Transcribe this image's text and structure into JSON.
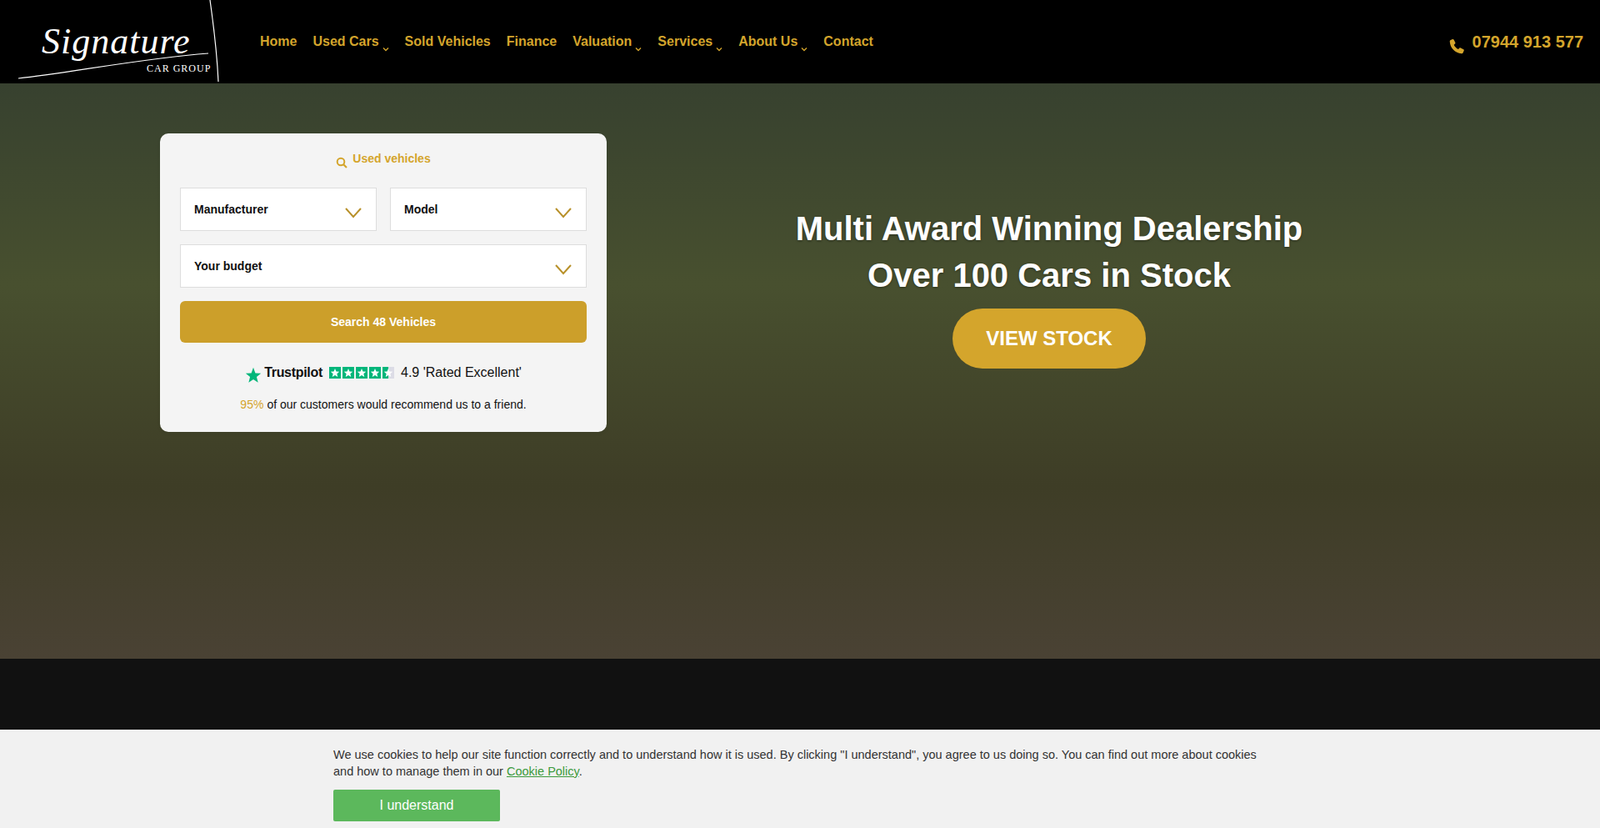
{
  "header": {
    "logo": {
      "script": "Signature",
      "sub": "CAR GROUP"
    },
    "nav": [
      {
        "label": "Home",
        "dropdown": false
      },
      {
        "label": "Used Cars",
        "dropdown": true
      },
      {
        "label": "Sold Vehicles",
        "dropdown": false
      },
      {
        "label": "Finance",
        "dropdown": false
      },
      {
        "label": "Valuation",
        "dropdown": true
      },
      {
        "label": "Services",
        "dropdown": true
      },
      {
        "label": "About Us",
        "dropdown": true
      },
      {
        "label": "Contact",
        "dropdown": false
      }
    ],
    "phone": "07944 913 577"
  },
  "search": {
    "title": "Used vehicles",
    "fields": [
      {
        "label": "Manufacturer"
      },
      {
        "label": "Model"
      },
      {
        "label": "Your budget"
      }
    ],
    "button": "Search 48 Vehicles",
    "trustpilot": {
      "brand": "Trustpilot",
      "stars": 4.5,
      "rating": "4.9 'Rated Excellent'"
    },
    "recommend": {
      "percent": "95%",
      "text": "of our customers would recommend us to a friend."
    }
  },
  "hero": {
    "headline": [
      "Multi Award Winning Dealership",
      "Over 100 Cars in Stock"
    ],
    "cta": "VIEW STOCK"
  },
  "cookie": {
    "text": "We use cookies to help our site function correctly and to understand how it is used. By clicking \"I understand\", you agree to us doing so. You can find out more about cookies and how to manage them in our ",
    "link": "Cookie Policy",
    "end": ".",
    "button": "I understand"
  }
}
